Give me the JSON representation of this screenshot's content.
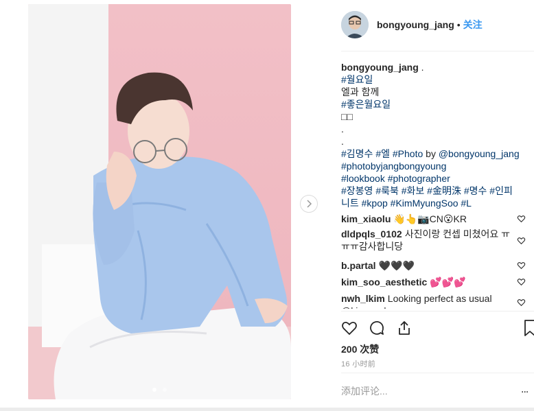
{
  "post": {
    "username": "bongyoung_jang",
    "separator": "•",
    "follow_label": "关注",
    "image_dots": 2,
    "active_dot": 0
  },
  "caption": {
    "owner": "bongyoung_jang",
    "lines": [
      {
        "text": " .",
        "kind": "plain"
      },
      {
        "text": "#월요일",
        "kind": "tag"
      },
      {
        "text": "엘과 함께",
        "kind": "plain"
      },
      {
        "text": "#좋은월요일",
        "kind": "tag"
      },
      {
        "text": "□□",
        "kind": "plain"
      },
      {
        "text": ".",
        "kind": "plain"
      },
      {
        "text": ".",
        "kind": "plain"
      }
    ],
    "line_tags_1": [
      {
        "text": "#김명수",
        "kind": "tag"
      },
      {
        "text": " ",
        "kind": "plain"
      },
      {
        "text": "#엘",
        "kind": "tag"
      },
      {
        "text": " ",
        "kind": "plain"
      },
      {
        "text": "#Photo",
        "kind": "tag"
      },
      {
        "text": " by ",
        "kind": "plain"
      },
      {
        "text": "@bongyoung_jang",
        "kind": "tag"
      }
    ],
    "line_tags_2": "#photobyjangbongyoung",
    "line_tags_3": "#lookbook #photographer",
    "line_tags_4": "#장봉영 #룩북 #화보 #金明洙 #명수 #인피",
    "line_tags_5": "니트 #kpop #KimMyungSoo #L"
  },
  "comments": [
    {
      "user": "kim_xiaolu",
      "text": "👋👆📷CN😮KR"
    },
    {
      "user": "dldpqls_0102",
      "text": "사진이랑 컨셉 미쳤어요 ㅠㅠㅠ감사합니당"
    },
    {
      "user": "b.partal",
      "text": "🖤🖤🖤"
    },
    {
      "user": "kim_soo_aesthetic",
      "text": "💕💕💕"
    },
    {
      "user": "nwh_lkim",
      "text": "Looking perfect as usual @kim_msl"
    }
  ],
  "stats": {
    "likes": "200 次赞",
    "time": "16 小时前"
  },
  "add_comment": {
    "placeholder": "添加评论...",
    "more": "..."
  },
  "icons": [
    "heart-icon",
    "comment-icon",
    "share-icon",
    "bookmark-icon",
    "chevron-right-icon"
  ],
  "colors": {
    "link": "#003569",
    "follow": "#3897f0",
    "muted": "#999999"
  }
}
